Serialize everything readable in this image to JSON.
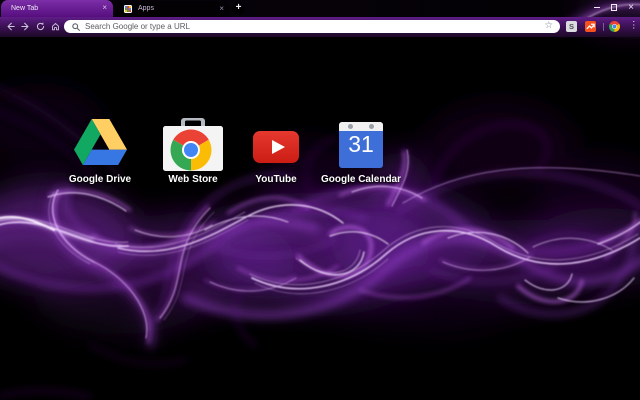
{
  "window": {
    "controls": {
      "minimize": "–",
      "maximize": "",
      "close": "×"
    }
  },
  "tabs": [
    {
      "label": "New Tab",
      "active": true
    },
    {
      "label": "Apps",
      "active": false
    }
  ],
  "newtab_button": "+",
  "toolbar": {
    "placeholder": "Search Google or type a URL",
    "star": "☆",
    "menu": "⋮"
  },
  "extensions": [
    {
      "label": "S"
    },
    {
      "label": ""
    }
  ],
  "shortcuts": [
    {
      "label": "Google Drive"
    },
    {
      "label": "Web Store"
    },
    {
      "label": "YouTube"
    },
    {
      "label": "Google Calendar"
    }
  ],
  "calendar_day": "31",
  "colors": {
    "theme_purple": "#6a1b96",
    "smoke_purple": "#b455e0",
    "page_background": "#000000",
    "youtube_red": "#cc1d14",
    "calendar_blue": "#3e6fd8"
  }
}
